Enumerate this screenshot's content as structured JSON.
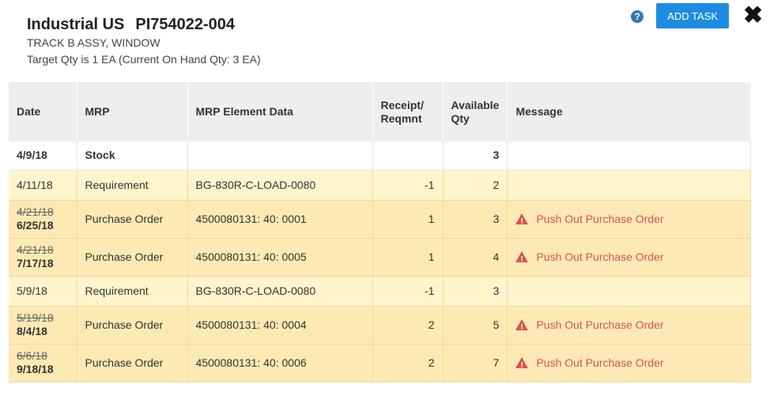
{
  "header": {
    "company": "Industrial US",
    "part_number": "PI754022-004",
    "description": "TRACK B ASSY, WINDOW",
    "target_qty": "Target Qty is 1 EA (Current On Hand Qty: 3 EA)"
  },
  "actions": {
    "help_glyph": "?",
    "add_task_label": "ADD TASK",
    "close_glyph": "✖"
  },
  "columns": {
    "date": "Date",
    "mrp": "MRP",
    "element": "MRP Element Data",
    "receipt_line1": "Receipt/",
    "receipt_line2": "Reqmnt",
    "available_line1": "Available",
    "available_line2": "Qty",
    "message": "Message"
  },
  "rows": [
    {
      "type": "stock",
      "date": "4/9/18",
      "mrp": "Stock",
      "element": "",
      "receipt": "",
      "available": "3",
      "message": ""
    },
    {
      "type": "req",
      "date": "4/11/18",
      "mrp": "Requirement",
      "element": "BG-830R-C-LOAD-0080",
      "receipt": "-1",
      "available": "2",
      "message": ""
    },
    {
      "type": "po",
      "old_date": "4/21/18",
      "new_date": "6/25/18",
      "mrp": "Purchase Order",
      "element": "4500080131: 40: 0001",
      "receipt": "1",
      "available": "3",
      "message": "Push Out Purchase Order"
    },
    {
      "type": "po",
      "old_date": "4/21/18",
      "new_date": "7/17/18",
      "mrp": "Purchase Order",
      "element": "4500080131: 40: 0005",
      "receipt": "1",
      "available": "4",
      "message": "Push Out Purchase Order"
    },
    {
      "type": "req",
      "date": "5/9/18",
      "mrp": "Requirement",
      "element": "BG-830R-C-LOAD-0080",
      "receipt": "-1",
      "available": "3",
      "message": ""
    },
    {
      "type": "po",
      "old_date": "5/19/18",
      "new_date": "8/4/18",
      "mrp": "Purchase Order",
      "element": "4500080131: 40: 0004",
      "receipt": "2",
      "available": "5",
      "message": "Push Out Purchase Order"
    },
    {
      "type": "po",
      "old_date": "6/6/18",
      "new_date": "9/18/18",
      "mrp": "Purchase Order",
      "element": "4500080131: 40: 0006",
      "receipt": "2",
      "available": "7",
      "message": "Push Out Purchase Order"
    }
  ],
  "colors": {
    "accent": "#1d8ce0",
    "warning": "#d9534f",
    "requirement_row": "#fff4cc",
    "purchase_order_row": "#fde9b3"
  }
}
